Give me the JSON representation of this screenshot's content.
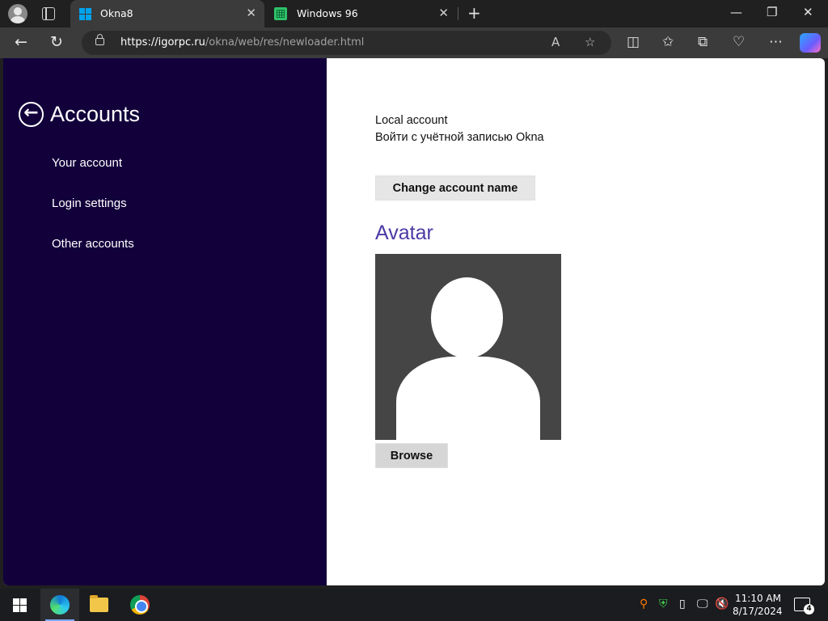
{
  "browser": {
    "tabs": [
      {
        "title": "Okna8",
        "active": true
      },
      {
        "title": "Windows 96",
        "active": false
      }
    ],
    "address": {
      "domain": "https://igorpc.ru",
      "path": "/okna/web/res/newloader.html"
    }
  },
  "sidebar": {
    "title": "Accounts",
    "items": [
      {
        "label": "Your account"
      },
      {
        "label": "Login settings"
      },
      {
        "label": "Other accounts"
      }
    ]
  },
  "content": {
    "account_type": "Local account",
    "login_hint": "Войти с учётной записью Okna",
    "change_name_button": "Change account name",
    "avatar_title": "Avatar",
    "browse_button": "Browse"
  },
  "colors": {
    "sidebar_bg": "#12003b",
    "avatar_title": "#4b3aa6"
  },
  "taskbar": {
    "time": "11:10 AM",
    "date": "8/17/2024",
    "notification_count": "4"
  }
}
